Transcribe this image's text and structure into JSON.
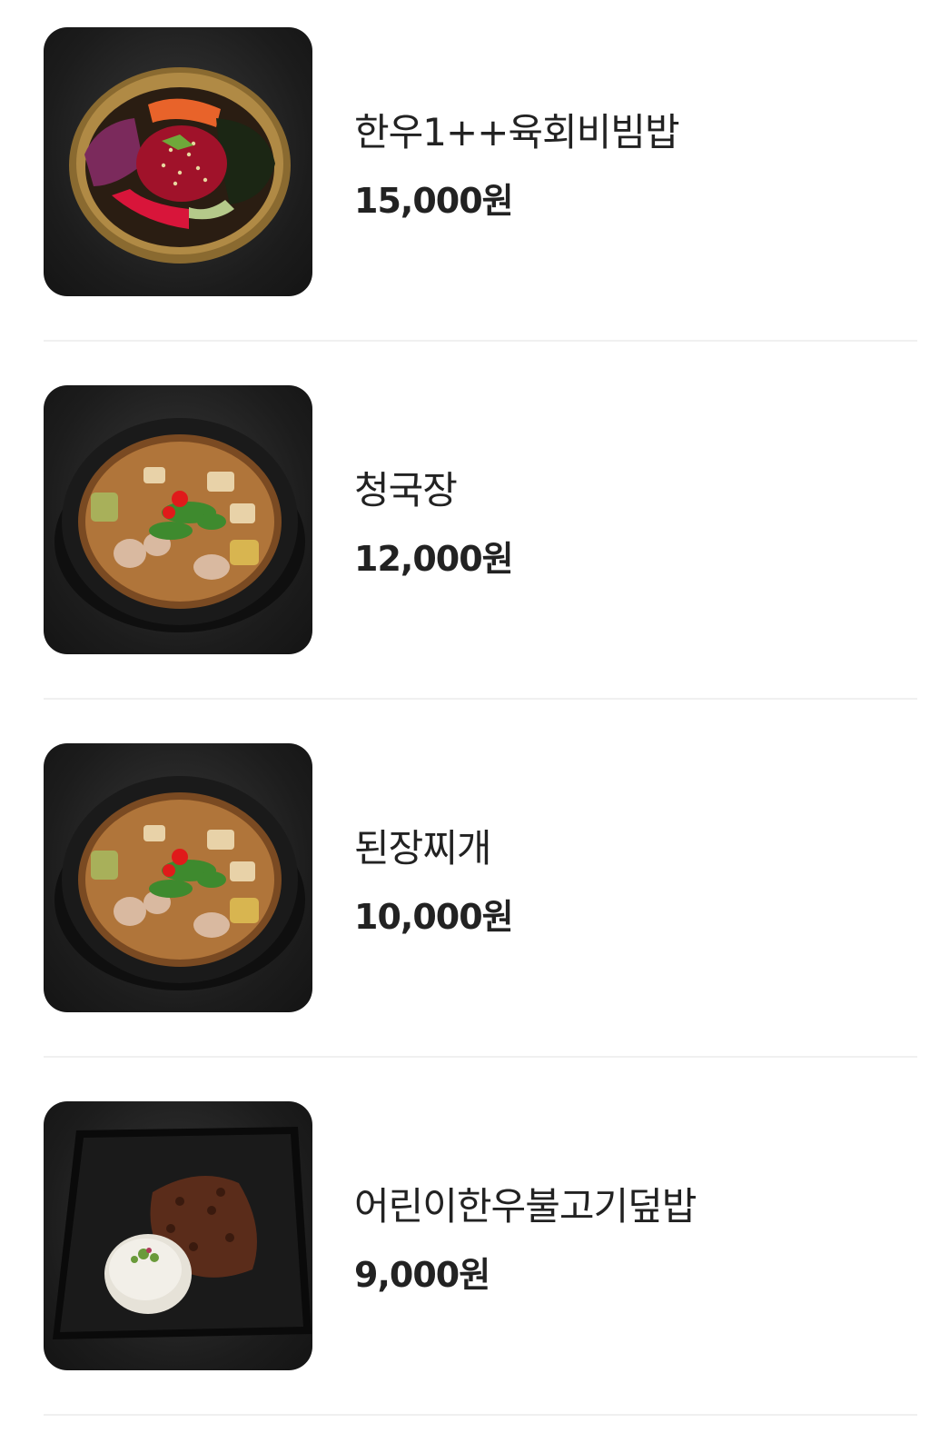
{
  "menu": {
    "items": [
      {
        "name": "한우1++육회비빔밥",
        "price": "15,000원",
        "image_icon": "bibimbap-bowl-photo"
      },
      {
        "name": "청국장",
        "price": "12,000원",
        "image_icon": "stew-pot-photo"
      },
      {
        "name": "된장찌개",
        "price": "10,000원",
        "image_icon": "stew-pot-photo"
      },
      {
        "name": "어린이한우불고기덮밥",
        "price": "9,000원",
        "image_icon": "bulgogi-rice-plate-photo"
      }
    ]
  },
  "colors": {
    "text": "#222222",
    "divider": "#f0f0f0",
    "thumb_background": "#1c1c1c"
  }
}
